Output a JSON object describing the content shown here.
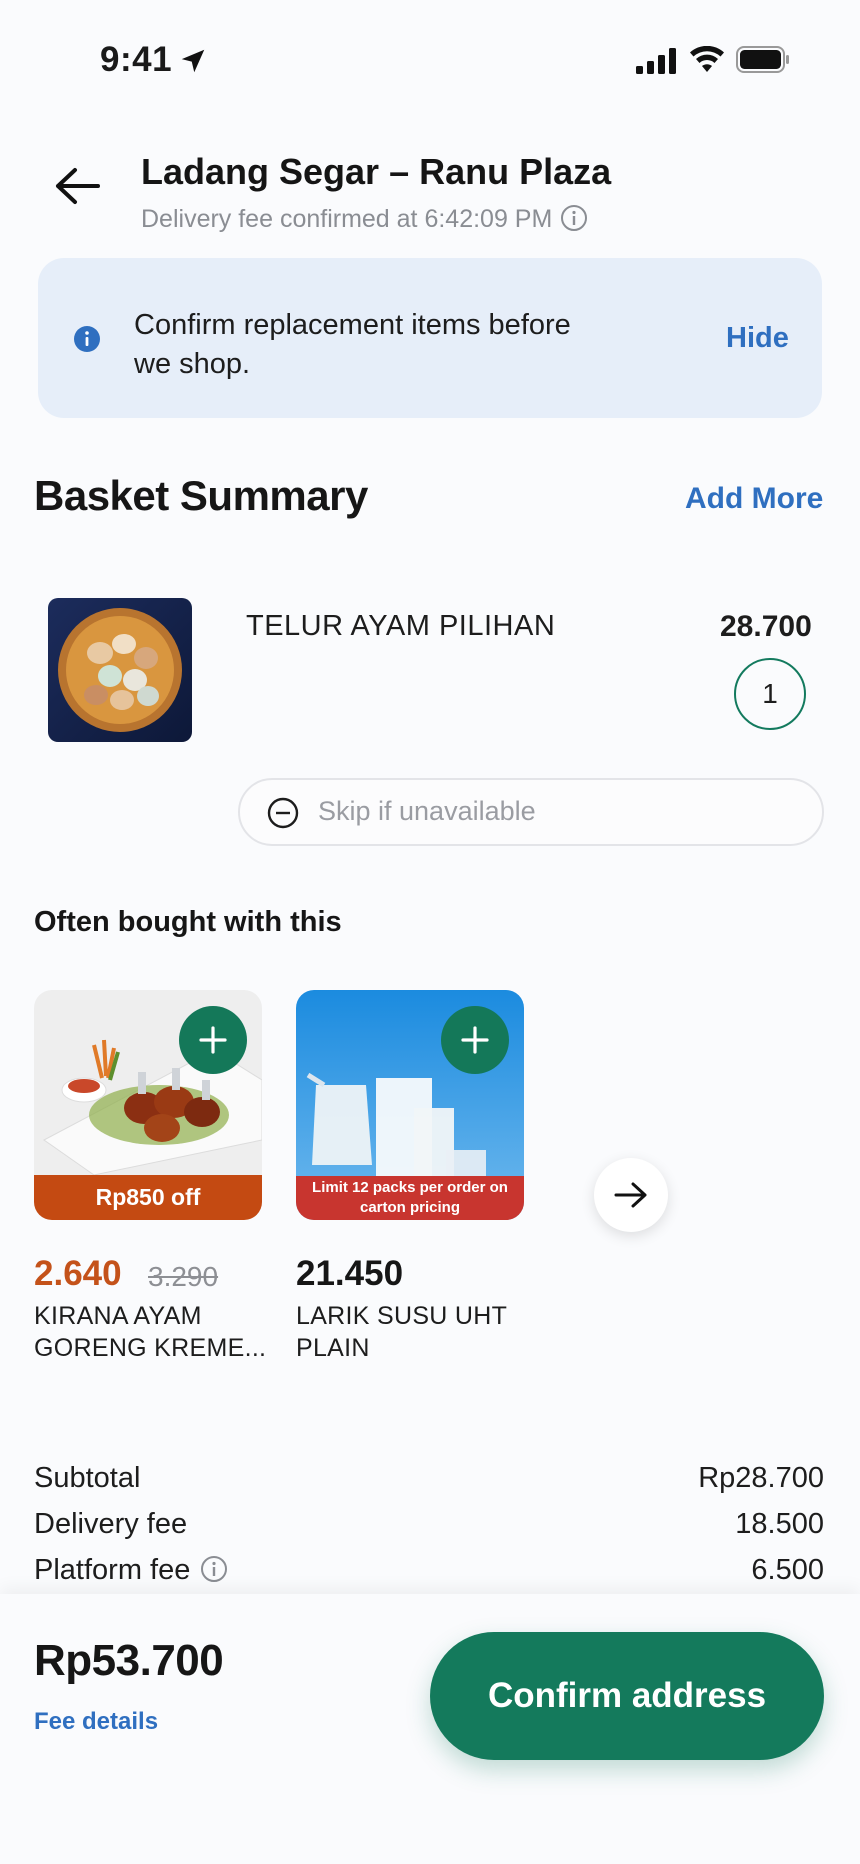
{
  "status_bar": {
    "time": "9:41"
  },
  "header": {
    "title": "Ladang Segar – Ranu Plaza",
    "subtitle": "Delivery fee confirmed at 6:42:09 PM"
  },
  "banner": {
    "text": "Confirm replacement items before we shop.",
    "hide_label": "Hide"
  },
  "basket": {
    "title": "Basket Summary",
    "add_more_label": "Add More",
    "items": [
      {
        "name": "TELUR AYAM PILIHAN",
        "price": "28.700",
        "quantity": "1",
        "substitution": "Skip if unavailable"
      }
    ]
  },
  "recommendations": {
    "title": "Often bought with this",
    "products": [
      {
        "name": "KIRANA AYAM GORENG KREME...",
        "price": "2.640",
        "original_price": "3.290",
        "badge": "Rp850 off"
      },
      {
        "name": "LARIK SUSU UHT PLAIN",
        "price": "21.450",
        "badge": "Limit 12 packs per order on carton pricing"
      }
    ]
  },
  "summary": {
    "subtotal_label": "Subtotal",
    "subtotal": "Rp28.700",
    "delivery_label": "Delivery fee",
    "delivery": "18.500",
    "platform_label": "Platform fee",
    "platform": "6.500"
  },
  "footer": {
    "total": "Rp53.700",
    "fee_details_label": "Fee details",
    "confirm_label": "Confirm address"
  },
  "colors": {
    "brand_green": "#147a5c",
    "link_blue": "#2f6fc0",
    "promo_orange": "#c44a12",
    "limit_red": "#c8352f",
    "banner_bg": "#e6eef9"
  }
}
